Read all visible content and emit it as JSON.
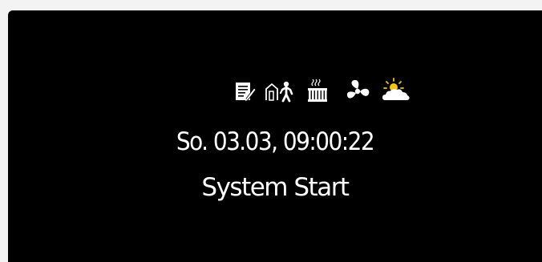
{
  "display": {
    "datetime": "So. 03.03, 09:00:22",
    "status": "System Start"
  },
  "icons": [
    "note-icon",
    "person-leaving-house-icon",
    "radiator-icon",
    "fan-icon",
    "sun-cloud-icon"
  ],
  "colors": {
    "background": "#000000",
    "text": "#ffffff",
    "sun": "#f2c318"
  }
}
